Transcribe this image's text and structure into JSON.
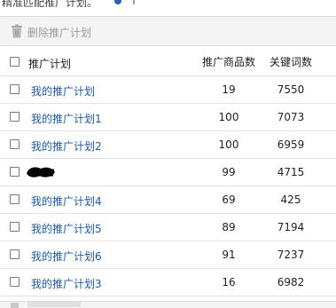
{
  "top_fragment": {
    "text": "精准匹配推广计划。",
    "after": "↑"
  },
  "toolbar": {
    "delete_label": "删除推广计划"
  },
  "table": {
    "headers": {
      "name": "推广计划",
      "products": "推广商品数",
      "keywords": "关键词数"
    },
    "rows": [
      {
        "name": "我的推广计划",
        "products": "19",
        "keywords": "7550",
        "redacted": false
      },
      {
        "name": "我的推广计划1",
        "products": "100",
        "keywords": "7073",
        "redacted": false
      },
      {
        "name": "我的推广计划2",
        "products": "100",
        "keywords": "6959",
        "redacted": false
      },
      {
        "name": "",
        "products": "99",
        "keywords": "4715",
        "redacted": true
      },
      {
        "name": "我的推广计划4",
        "products": "69",
        "keywords": "425",
        "redacted": false
      },
      {
        "name": "我的推广计划5",
        "products": "89",
        "keywords": "7194",
        "redacted": false
      },
      {
        "name": "我的推广计划6",
        "products": "91",
        "keywords": "7237",
        "redacted": false
      },
      {
        "name": "我的推广计划3",
        "products": "16",
        "keywords": "6982",
        "redacted": false
      }
    ]
  },
  "colors": {
    "link": "#1f5aa0",
    "toolbar_bg": "#f4f4f4",
    "border": "#dcdcdc",
    "disabled_text": "#9a9a9a"
  },
  "icons": {
    "toolbar": "trash-icon",
    "redaction": "scribble-redaction"
  }
}
